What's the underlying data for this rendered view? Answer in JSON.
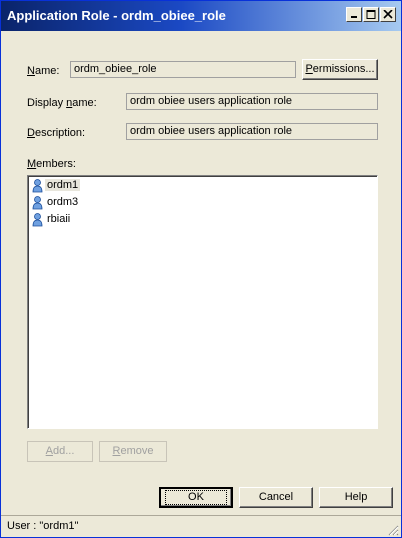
{
  "window": {
    "title": "Application Role - ordm_obiee_role"
  },
  "name": {
    "label": "Name:",
    "value": "ordm_obiee_role",
    "permissions_button": "Permissions..."
  },
  "display_name": {
    "label": "Display name:",
    "value": "ordm obiee users application role"
  },
  "description": {
    "label": "Description:",
    "value": "ordm obiee users application role"
  },
  "members": {
    "label": "Members:",
    "items": [
      {
        "name": "ordm1",
        "icon": "user-icon",
        "selected": true
      },
      {
        "name": "ordm3",
        "icon": "user-icon",
        "selected": false
      },
      {
        "name": "rbiaii",
        "icon": "user-icon",
        "selected": false
      }
    ],
    "add_button": "Add...",
    "remove_button": "Remove"
  },
  "buttons": {
    "ok": "OK",
    "cancel": "Cancel",
    "help": "Help"
  },
  "status": {
    "text": "User : \"ordm1\""
  }
}
